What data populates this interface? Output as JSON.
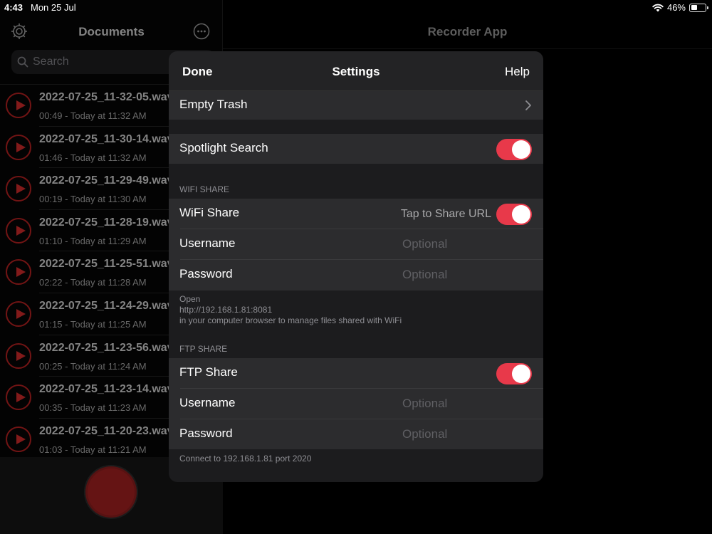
{
  "status_bar": {
    "time": "4:43",
    "date": "Mon 25 Jul",
    "battery": "46%",
    "battery_level": 0.46
  },
  "sidebar": {
    "title": "Documents",
    "search_placeholder": "Search",
    "items": [
      {
        "name": "2022-07-25_11-32-05.wav",
        "meta": "00:49 - Today at 11:32 AM"
      },
      {
        "name": "2022-07-25_11-30-14.wav",
        "meta": "01:46 - Today at 11:32 AM"
      },
      {
        "name": "2022-07-25_11-29-49.wav",
        "meta": "00:19 - Today at 11:30 AM"
      },
      {
        "name": "2022-07-25_11-28-19.wav",
        "meta": "01:10 - Today at 11:29 AM"
      },
      {
        "name": "2022-07-25_11-25-51.wav",
        "meta": "02:22 - Today at 11:28 AM"
      },
      {
        "name": "2022-07-25_11-24-29.wav",
        "meta": "01:15 - Today at 11:25 AM"
      },
      {
        "name": "2022-07-25_11-23-56.wav",
        "meta": "00:25 - Today at 11:24 AM"
      },
      {
        "name": "2022-07-25_11-23-14.wav",
        "meta": "00:35 - Today at 11:23 AM"
      },
      {
        "name": "2022-07-25_11-20-23.wav",
        "meta": "01:03 - Today at 11:21 AM"
      }
    ]
  },
  "main": {
    "title": "Recorder App"
  },
  "settings": {
    "done": "Done",
    "title": "Settings",
    "help": "Help",
    "empty_trash": "Empty Trash",
    "spotlight": "Spotlight Search",
    "wifi_header": "WIFI SHARE",
    "wifi_share": "WiFi Share",
    "wifi_hint": "Tap to Share URL",
    "wifi_username": "Username",
    "wifi_username_placeholder": "Optional",
    "wifi_password": "Password",
    "wifi_password_placeholder": "Optional",
    "wifi_footer_1": "Open",
    "wifi_footer_2": "http://192.168.1.81:8081",
    "wifi_footer_3": "in your computer browser to manage files shared with WiFi",
    "ftp_header": "FTP SHARE",
    "ftp_share": "FTP Share",
    "ftp_username": "Username",
    "ftp_username_placeholder": "Optional",
    "ftp_password": "Password",
    "ftp_password_placeholder": "Optional",
    "ftp_footer": "Connect to 192.168.1.81 port 2020"
  },
  "colors": {
    "accent": "#e8394a",
    "record": "#9b1f1f",
    "play": "#c82828"
  },
  "icons": [
    "gear-icon",
    "more-icon",
    "search-icon",
    "play-icon",
    "record-icon",
    "chevron-right-icon",
    "wifi-icon",
    "battery-icon"
  ]
}
